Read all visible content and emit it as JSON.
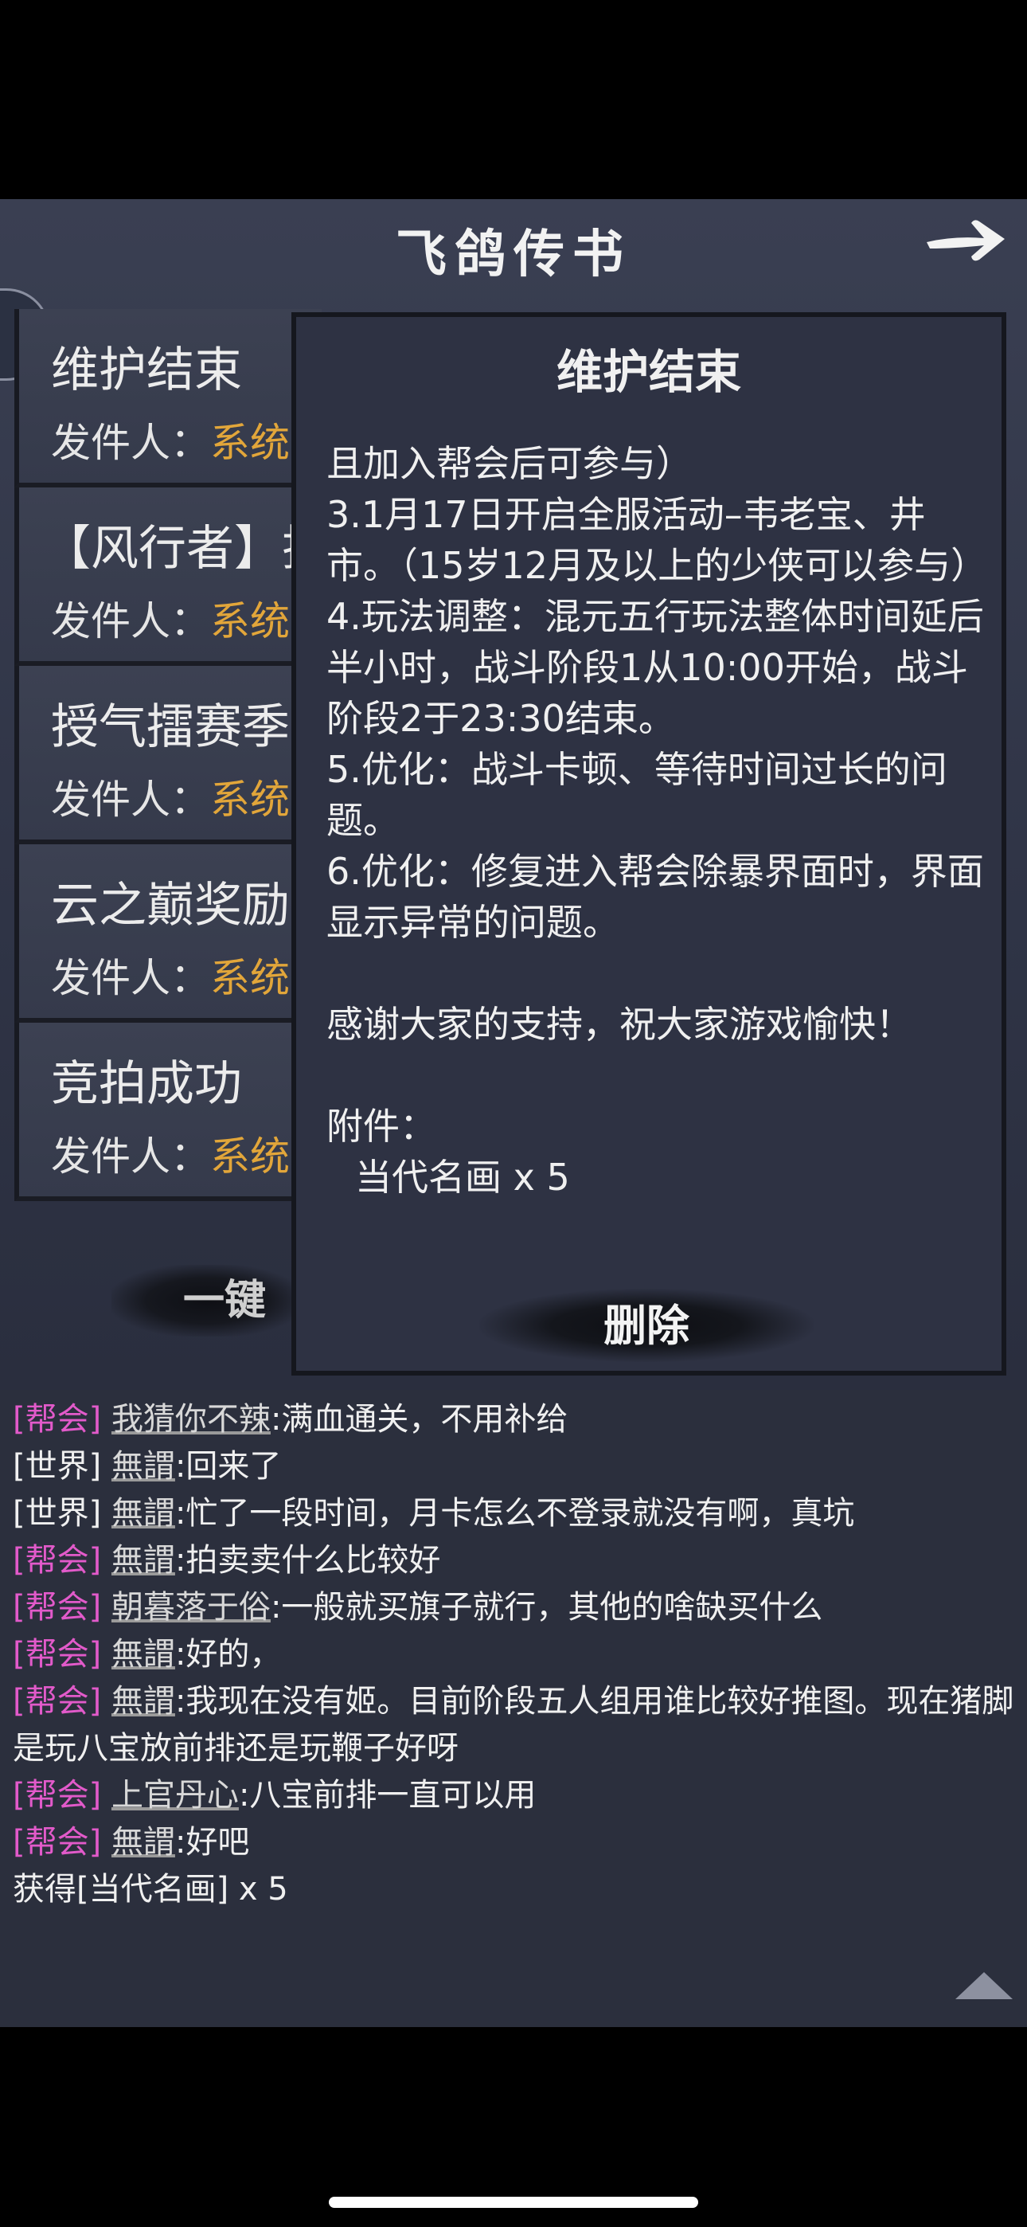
{
  "header": {
    "title": "飞鸽传书",
    "next_icon": "arrow-right-icon"
  },
  "mail_list": [
    {
      "title": "维护结束",
      "sender_label": "发件人：",
      "sender": "系统"
    },
    {
      "title": "【风行者】技",
      "sender_label": "发件人：",
      "sender": "系统"
    },
    {
      "title": "授气擂赛季",
      "sender_label": "发件人：",
      "sender": "系统"
    },
    {
      "title": "云之巅奖励",
      "sender_label": "发件人：",
      "sender": "系统"
    },
    {
      "title": "竞拍成功",
      "sender_label": "发件人：",
      "sender": "系统"
    }
  ],
  "one_key_label": "一键",
  "detail": {
    "title": "维护结束",
    "body": [
      "且加入帮会后可参与）",
      "3.1月17日开启全服活动–韦老宝、井市。（15岁12月及以上的少侠可以参与）",
      "4.玩法调整：混元五行玩法整体时间延后半小时，战斗阶段1从10:00开始，战斗阶段2于23:30结束。",
      "5.优化：战斗卡顿、等待时间过长的问题。",
      "6.优化：修复进入帮会除暴界面时，界面显示异常的问题。"
    ],
    "thanks": "感谢大家的支持，祝大家游戏愉快！",
    "attachment_label": "附件：",
    "attachment_item": "当代名画 x 5",
    "delete_label": "删除"
  },
  "chat": [
    {
      "tag": "[帮会]",
      "user": "我猜你不辣",
      "msg": ":满血通关，不用补给"
    },
    {
      "tag": "[世界]",
      "user": "無謂",
      "msg": ":回来了"
    },
    {
      "tag": "[世界]",
      "user": "無謂",
      "msg": ":忙了一段时间，月卡怎么不登录就没有啊，真坑"
    },
    {
      "tag": "[帮会]",
      "user": "無謂",
      "msg": ":拍卖卖什么比较好"
    },
    {
      "tag": "[帮会]",
      "user": "朝暮落于俗",
      "msg": ":一般就买旗子就行，其他的啥缺买什么"
    },
    {
      "tag": "[帮会]",
      "user": "無謂",
      "msg": ":好的，"
    },
    {
      "tag": "[帮会]",
      "user": "無謂",
      "msg": ":我现在没有姬。目前阶段五人组用谁比较好推图。现在猪脚是玩八宝放前排还是玩鞭子好呀"
    },
    {
      "tag": "[帮会]",
      "user": "上官丹心",
      "msg": ":八宝前排一直可以用"
    },
    {
      "tag": "[帮会]",
      "user": "無謂",
      "msg": ":好吧"
    }
  ],
  "system_msg": "获得[当代名画] x 5",
  "colors": {
    "guild_tag": "#e25aca",
    "sender_system": "#e2a63a",
    "panel_bg": "#353a4b"
  }
}
